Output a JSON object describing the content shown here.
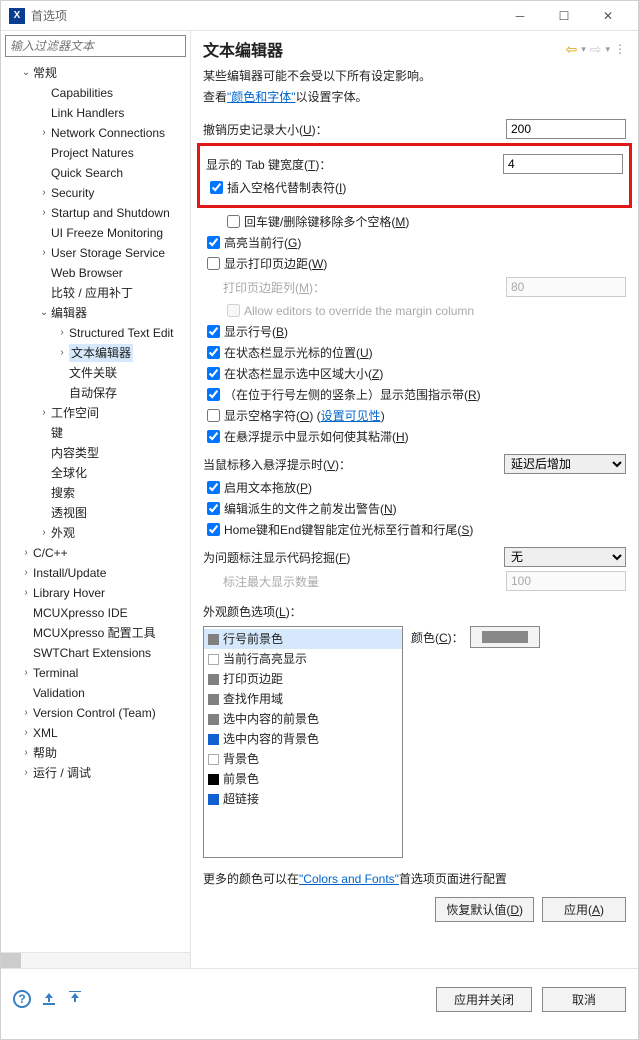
{
  "window": {
    "title": "首选项"
  },
  "filter_placeholder": "输入过滤器文本",
  "tree": [
    [
      "常规",
      1,
      "open"
    ],
    [
      "Capabilities",
      2,
      ""
    ],
    [
      "Link Handlers",
      2,
      ""
    ],
    [
      "Network Connections",
      2,
      "closed"
    ],
    [
      "Project Natures",
      2,
      ""
    ],
    [
      "Quick Search",
      2,
      ""
    ],
    [
      "Security",
      2,
      "closed"
    ],
    [
      "Startup and Shutdown",
      2,
      "closed"
    ],
    [
      "UI Freeze Monitoring",
      2,
      ""
    ],
    [
      "User Storage Service",
      2,
      "closed"
    ],
    [
      "Web Browser",
      2,
      ""
    ],
    [
      "比较 / 应用补丁",
      2,
      ""
    ],
    [
      "编辑器",
      2,
      "open"
    ],
    [
      "Structured Text Edit",
      3,
      "closed"
    ],
    [
      "文本编辑器",
      3,
      "closed",
      true
    ],
    [
      "文件关联",
      3,
      ""
    ],
    [
      "自动保存",
      3,
      ""
    ],
    [
      "工作空间",
      2,
      "closed"
    ],
    [
      "键",
      2,
      ""
    ],
    [
      "内容类型",
      2,
      ""
    ],
    [
      "全球化",
      2,
      ""
    ],
    [
      "搜索",
      2,
      ""
    ],
    [
      "透视图",
      2,
      ""
    ],
    [
      "外观",
      2,
      "closed"
    ],
    [
      "C/C++",
      1,
      "closed"
    ],
    [
      "Install/Update",
      1,
      "closed"
    ],
    [
      "Library Hover",
      1,
      "closed"
    ],
    [
      "MCUXpresso IDE",
      1,
      ""
    ],
    [
      "MCUXpresso 配置工具",
      1,
      ""
    ],
    [
      "SWTChart Extensions",
      1,
      ""
    ],
    [
      "Terminal",
      1,
      "closed"
    ],
    [
      "Validation",
      1,
      ""
    ],
    [
      "Version Control (Team)",
      1,
      "closed"
    ],
    [
      "XML",
      1,
      "closed"
    ],
    [
      "帮助",
      1,
      "closed"
    ],
    [
      "运行 / 调试",
      1,
      "closed"
    ]
  ],
  "content": {
    "title": "文本编辑器",
    "desc1": "某些编辑器可能不会受以下所有设定影响。",
    "desc2_pre": "查看",
    "desc2_link": "\"颜色和字体\"",
    "desc2_post": "以设置字体。",
    "undo_label": "撤销历史记录大小(",
    "undo_key": "U",
    "undo_value": "200",
    "tab_label": "显示的 Tab 键宽度(",
    "tab_key": "T",
    "tab_value": "4",
    "insert_spaces": "插入空格代替制表符(",
    "insert_spaces_key": "I",
    "remove_multi": "回车键/删除键移除多个空格(",
    "remove_multi_key": "M",
    "highlight_line": "高亮当前行(",
    "highlight_line_key": "G",
    "show_margin": "显示打印页边距(",
    "show_margin_key": "W",
    "margin_col": "打印页边距列(",
    "margin_col_key": "M",
    "margin_col_value": "80",
    "allow_override": "Allow editors to override the margin column",
    "show_linenum": "显示行号(",
    "show_linenum_key": "B",
    "status_cursor": "在状态栏显示光标的位置(",
    "status_cursor_key": "U",
    "status_selection": "在状态栏显示选中区域大小(",
    "status_selection_key": "Z",
    "range_indicator": "（在位于行号左侧的竖条上）显示范围指示带(",
    "range_indicator_key": "R",
    "show_whitespace": "显示空格字符(",
    "show_whitespace_key": "O",
    "show_whitespace_link": "设置可见性",
    "hover_sticky": "在悬浮提示中显示如何使其粘滞(",
    "hover_sticky_key": "H",
    "hover_when": "当鼠标移入悬浮提示时(",
    "hover_when_key": "V",
    "hover_when_value": "延迟后增加",
    "enable_dnd": "启用文本拖放(",
    "enable_dnd_key": "P",
    "warn_derived": "编辑派生的文件之前发出警告(",
    "warn_derived_key": "N",
    "smart_home": "Home键和End键智能定位光标至行首和行尾(",
    "smart_home_key": "S",
    "code_mining": "为问题标注显示代码挖掘(",
    "code_mining_key": "F",
    "code_mining_value": "无",
    "max_annotations": "标注最大显示数量",
    "max_annotations_value": "100",
    "appearance_label": "外观颜色选项(",
    "appearance_key": "L",
    "color_items": [
      {
        "name": "行号前景色",
        "color": "#808080",
        "sel": true
      },
      {
        "name": "当前行高亮显示",
        "color": "#ffffff"
      },
      {
        "name": "打印页边距",
        "color": "#808080"
      },
      {
        "name": "查找作用域",
        "color": "#808080"
      },
      {
        "name": "选中内容的前景色",
        "color": "#808080"
      },
      {
        "name": "选中内容的背景色",
        "color": "#1060d0"
      },
      {
        "name": "背景色",
        "color": "#ffffff"
      },
      {
        "name": "前景色",
        "color": "#000000"
      },
      {
        "name": "超链接",
        "color": "#1060d0"
      }
    ],
    "color_label": "颜色(",
    "color_key": "C",
    "more_colors_pre": "更多的颜色可以在",
    "more_colors_link": "\"Colors and Fonts\"",
    "more_colors_post": "首选项页面进行配置",
    "restore_defaults": "恢复默认值(",
    "restore_defaults_key": "D",
    "apply": "应用(",
    "apply_key": "A"
  },
  "footer": {
    "apply_close": "应用并关闭",
    "cancel": "取消"
  },
  "checkbox_states": {
    "insert_spaces": true,
    "remove_multi": false,
    "highlight_line": true,
    "show_margin": false,
    "allow_override": false,
    "show_linenum": true,
    "status_cursor": true,
    "status_selection": true,
    "range_indicator": true,
    "show_whitespace": false,
    "hover_sticky": true,
    "enable_dnd": true,
    "warn_derived": true,
    "smart_home": true
  }
}
